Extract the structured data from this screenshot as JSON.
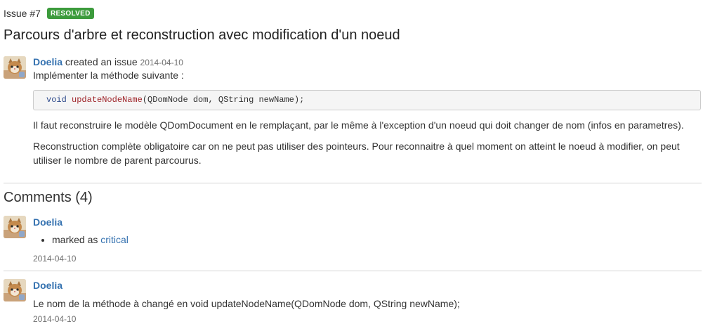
{
  "issue": {
    "number": "Issue #7",
    "status": "RESOLVED",
    "title": "Parcours d'arbre et reconstruction avec modification d'un noeud",
    "author": "Doelia",
    "action": "created an issue",
    "date": "2014-04-10",
    "intro": "Implémenter la méthode suivante :",
    "code": {
      "keyword": "void",
      "function": "updateNodeName",
      "args": "(QDomNode dom, QString newName);"
    },
    "paragraphs": [
      "Il faut reconstruire le modèle QDomDocument en le remplaçant, par le même à l'exception d'un noeud qui doit changer de nom (infos en parametres).",
      "Reconstruction complète obligatoire car on ne peut pas utiliser des pointeurs. Pour reconnaitre à quel moment on atteint le noeud à modifier, on peut utiliser le nombre de parent parcourus."
    ]
  },
  "comments": {
    "heading": "Comments (4)",
    "items": [
      {
        "author": "Doelia",
        "event_prefix": "marked as",
        "event_link": "critical",
        "date": "2014-04-10"
      },
      {
        "author": "Doelia",
        "text": "Le nom de la méthode à changé en void updateNodeName(QDomNode dom, QString newName);",
        "date": "2014-04-10"
      }
    ]
  },
  "colors": {
    "badge": "#3c9b3c",
    "link": "#3572b0"
  },
  "icons": {
    "avatar": "cat-avatar-icon"
  }
}
